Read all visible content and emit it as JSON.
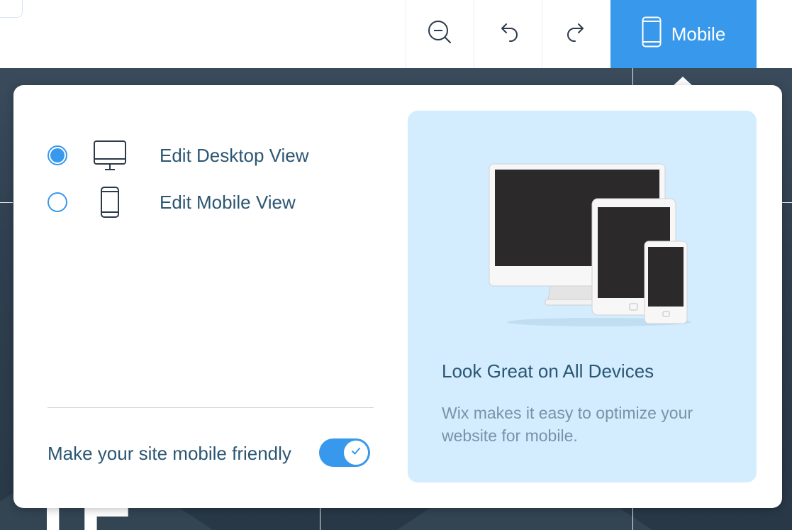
{
  "toolbar": {
    "zoom_out_icon": "zoom-out-icon",
    "undo_icon": "undo-icon",
    "redo_icon": "redo-icon",
    "mobile_icon": "smartphone-icon",
    "mobile_label": "Mobile",
    "accent_color": "#3899ec"
  },
  "popover": {
    "options": [
      {
        "label": "Edit Desktop View",
        "icon": "desktop-icon",
        "selected": true
      },
      {
        "label": "Edit Mobile View",
        "icon": "smartphone-icon",
        "selected": false
      }
    ],
    "mobile_friendly": {
      "label": "Make your site mobile friendly",
      "enabled": true
    }
  },
  "promo": {
    "title": "Look Great on All Devices",
    "text": "Wix makes it easy to optimize your website for mobile.",
    "illustration": "devices-illustration",
    "background": "#d3edff"
  }
}
